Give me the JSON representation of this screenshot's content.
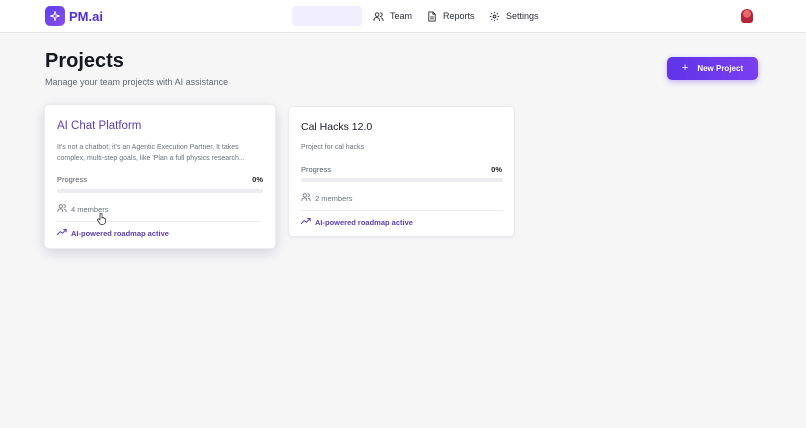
{
  "app": {
    "brand": "PM.ai"
  },
  "nav": {
    "items": [
      {
        "label": "Team",
        "icon": "users-icon"
      },
      {
        "label": "Reports",
        "icon": "document-icon"
      },
      {
        "label": "Settings",
        "icon": "gear-icon"
      }
    ]
  },
  "page": {
    "title": "Projects",
    "subtitle": "Manage your team projects with AI assistance",
    "new_project_label": "New Project"
  },
  "projects": [
    {
      "name": "AI Chat Platform",
      "description": "It's not a chatbot; it's an Agentic Execution Partner. It takes complex, multi-step goals, like 'Plan a full physics research...",
      "progress_label": "Progress",
      "progress_value": "0%",
      "progress_fraction": 0,
      "members": "4 members",
      "ai_status": "AI-powered roadmap active"
    },
    {
      "name": "Cal Hacks 12.0",
      "description": "Project for cal hacks",
      "progress_label": "Progress",
      "progress_value": "0%",
      "progress_fraction": 0,
      "members": "2 members",
      "ai_status": "AI-powered roadmap active"
    }
  ],
  "colors": {
    "accent": "#6a3fea",
    "brand": "#4f2fd6"
  }
}
